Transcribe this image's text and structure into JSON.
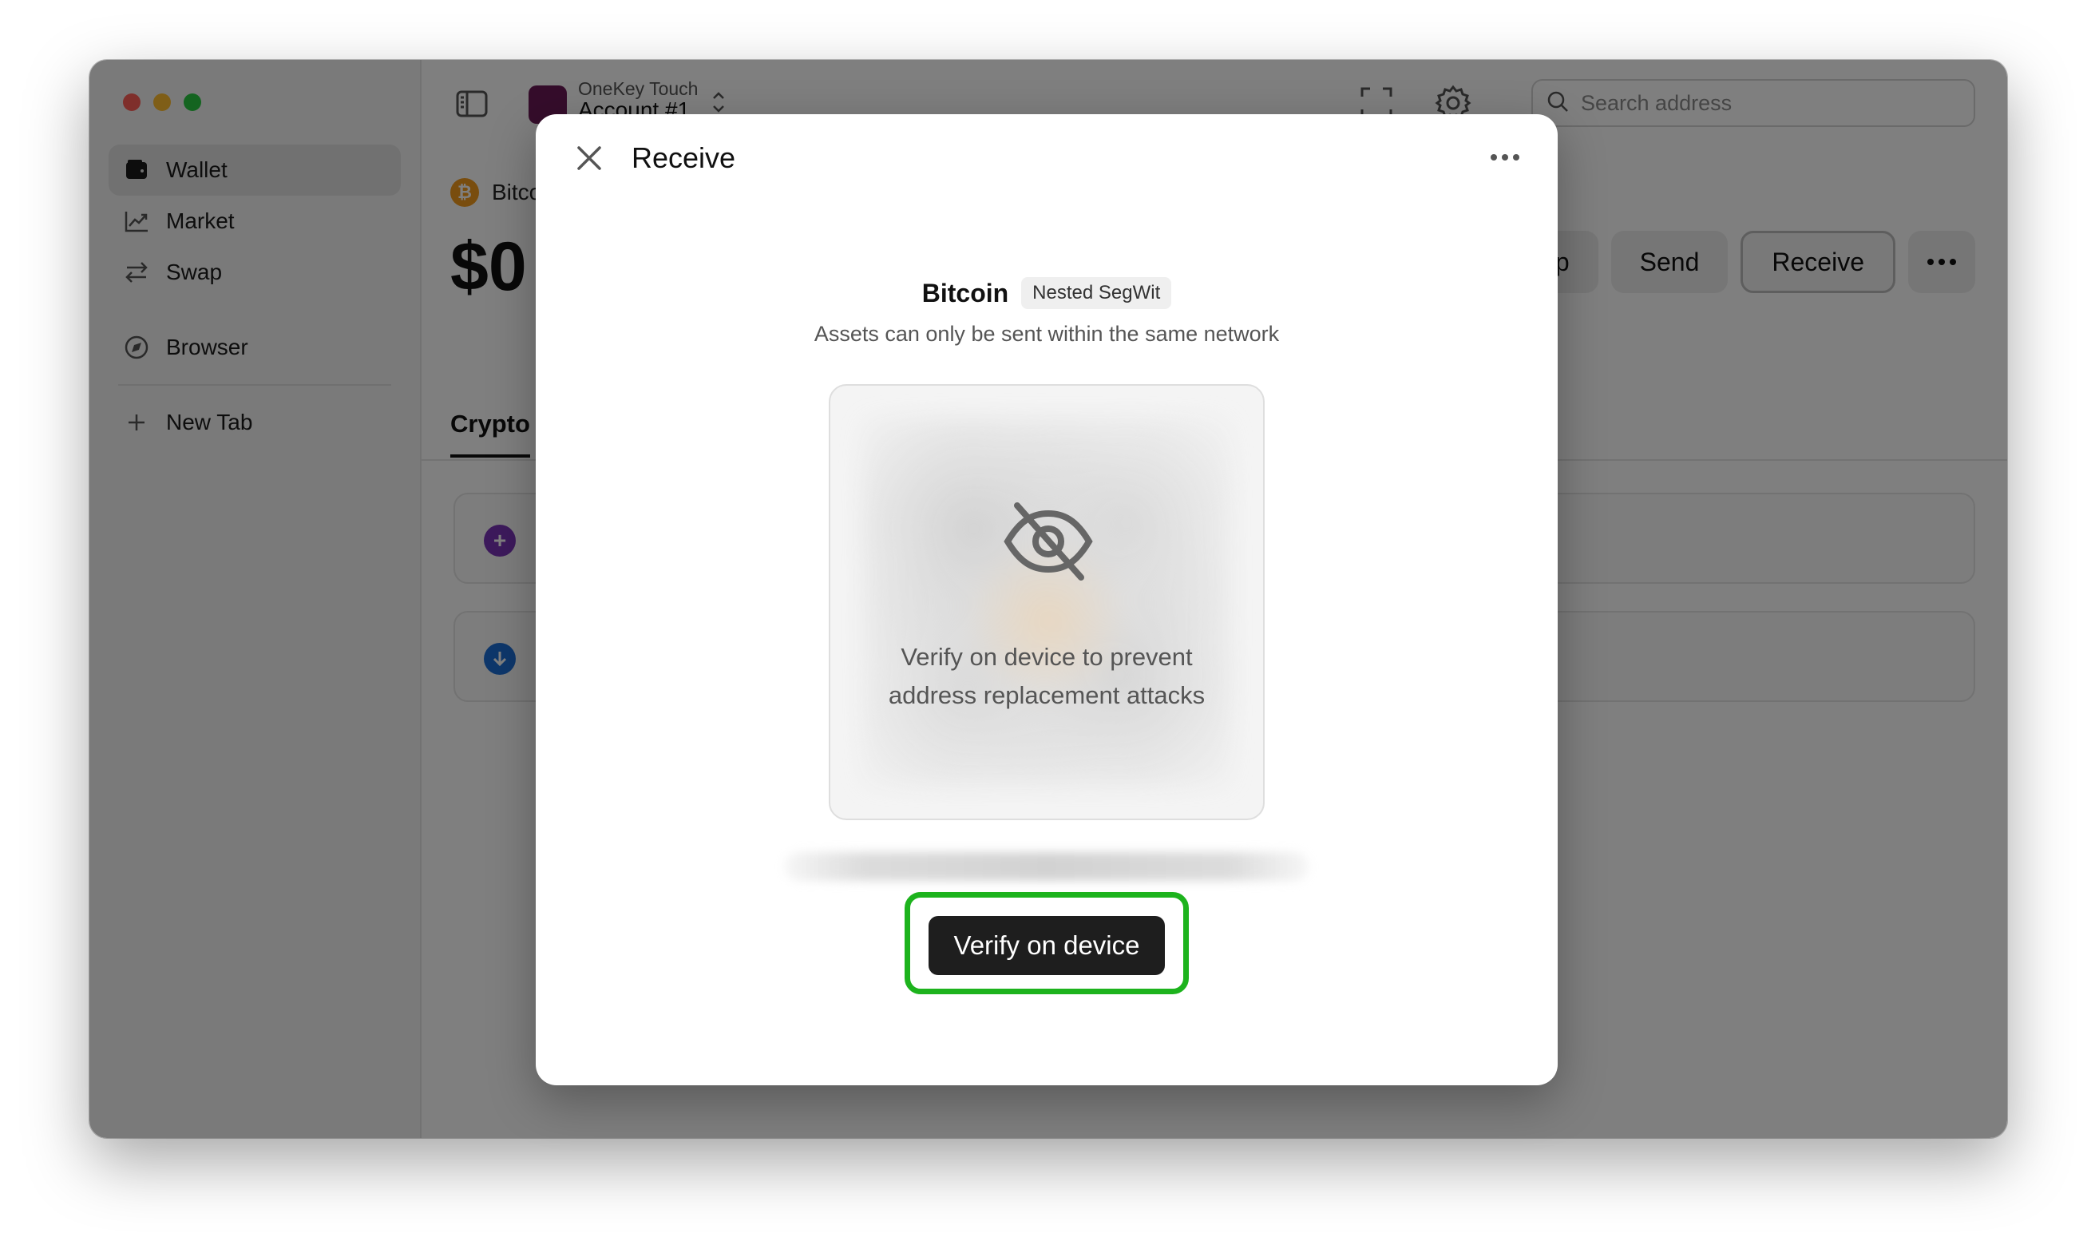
{
  "sidebar": {
    "items": [
      {
        "label": "Wallet",
        "icon": "wallet-icon"
      },
      {
        "label": "Market",
        "icon": "chart-line-icon"
      },
      {
        "label": "Swap",
        "icon": "swap-arrows-icon"
      },
      {
        "label": "Browser",
        "icon": "compass-icon"
      },
      {
        "label": "New Tab",
        "icon": "plus-icon"
      }
    ]
  },
  "header": {
    "device": "OneKey Touch",
    "account": "Account #1",
    "search_placeholder": "Search address"
  },
  "wallet": {
    "token": "Bitcoin",
    "balance": "$0",
    "actions": {
      "swap": "Swap",
      "send": "Send",
      "receive": "Receive"
    },
    "tab": "Crypto"
  },
  "modal": {
    "title": "Receive",
    "network_name": "Bitcoin",
    "network_badge": "Nested SegWit",
    "note": "Assets can only be sent within the same network",
    "qr_message": "Verify on device to prevent address replacement attacks",
    "verify_button": "Verify on device"
  },
  "colors": {
    "accent_highlight": "#1db31d",
    "button_dark": "#1e1e1e",
    "bitcoin": "#f39b1c"
  }
}
